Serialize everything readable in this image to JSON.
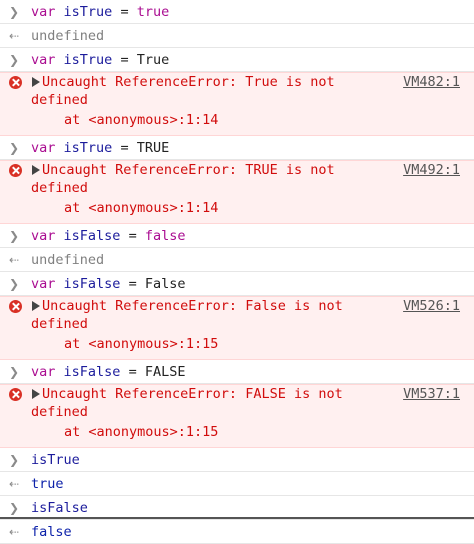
{
  "prompt_icons": {
    "input": "chevron-right-icon",
    "result": "arrow-left-icon",
    "error": "error-circle-icon"
  },
  "colors": {
    "error_bg": "#fff0f0",
    "error_text": "#d10c0c",
    "keyword": "#aa0d91"
  },
  "rows": [
    {
      "type": "input",
      "kw": "var",
      "id": "isTrue",
      "op": "=",
      "val": "true",
      "valclass": "kw"
    },
    {
      "type": "result",
      "text": "undefined",
      "cls": "undef"
    },
    {
      "type": "input",
      "kw": "var",
      "id": "isTrue",
      "op": "=",
      "val": "True",
      "valclass": "plain"
    },
    {
      "type": "error",
      "msg": "Uncaught ReferenceError: True is not defined",
      "at": "at <anonymous>:1:14",
      "link": "VM482:1"
    },
    {
      "type": "input",
      "kw": "var",
      "id": "isTrue",
      "op": "=",
      "val": "TRUE",
      "valclass": "plain"
    },
    {
      "type": "error",
      "msg": "Uncaught ReferenceError: TRUE is not defined",
      "at": "at <anonymous>:1:14",
      "link": "VM492:1"
    },
    {
      "type": "input",
      "kw": "var",
      "id": "isFalse",
      "op": "=",
      "val": "false",
      "valclass": "kw"
    },
    {
      "type": "result",
      "text": "undefined",
      "cls": "undef"
    },
    {
      "type": "input",
      "kw": "var",
      "id": "isFalse",
      "op": "=",
      "val": "False",
      "valclass": "plain"
    },
    {
      "type": "error",
      "msg": "Uncaught ReferenceError: False is not defined",
      "at": "at <anonymous>:1:15",
      "link": "VM526:1"
    },
    {
      "type": "input",
      "kw": "var",
      "id": "isFalse",
      "op": "=",
      "val": "FALSE",
      "valclass": "plain"
    },
    {
      "type": "error",
      "msg": "Uncaught ReferenceError: FALSE is not defined",
      "at": "at <anonymous>:1:15",
      "link": "VM537:1"
    },
    {
      "type": "input-plain",
      "text": "isTrue"
    },
    {
      "type": "result",
      "text": "true",
      "cls": "bool"
    },
    {
      "type": "input-plain",
      "text": "isFalse"
    },
    {
      "type": "result",
      "text": "false",
      "cls": "bool"
    }
  ]
}
